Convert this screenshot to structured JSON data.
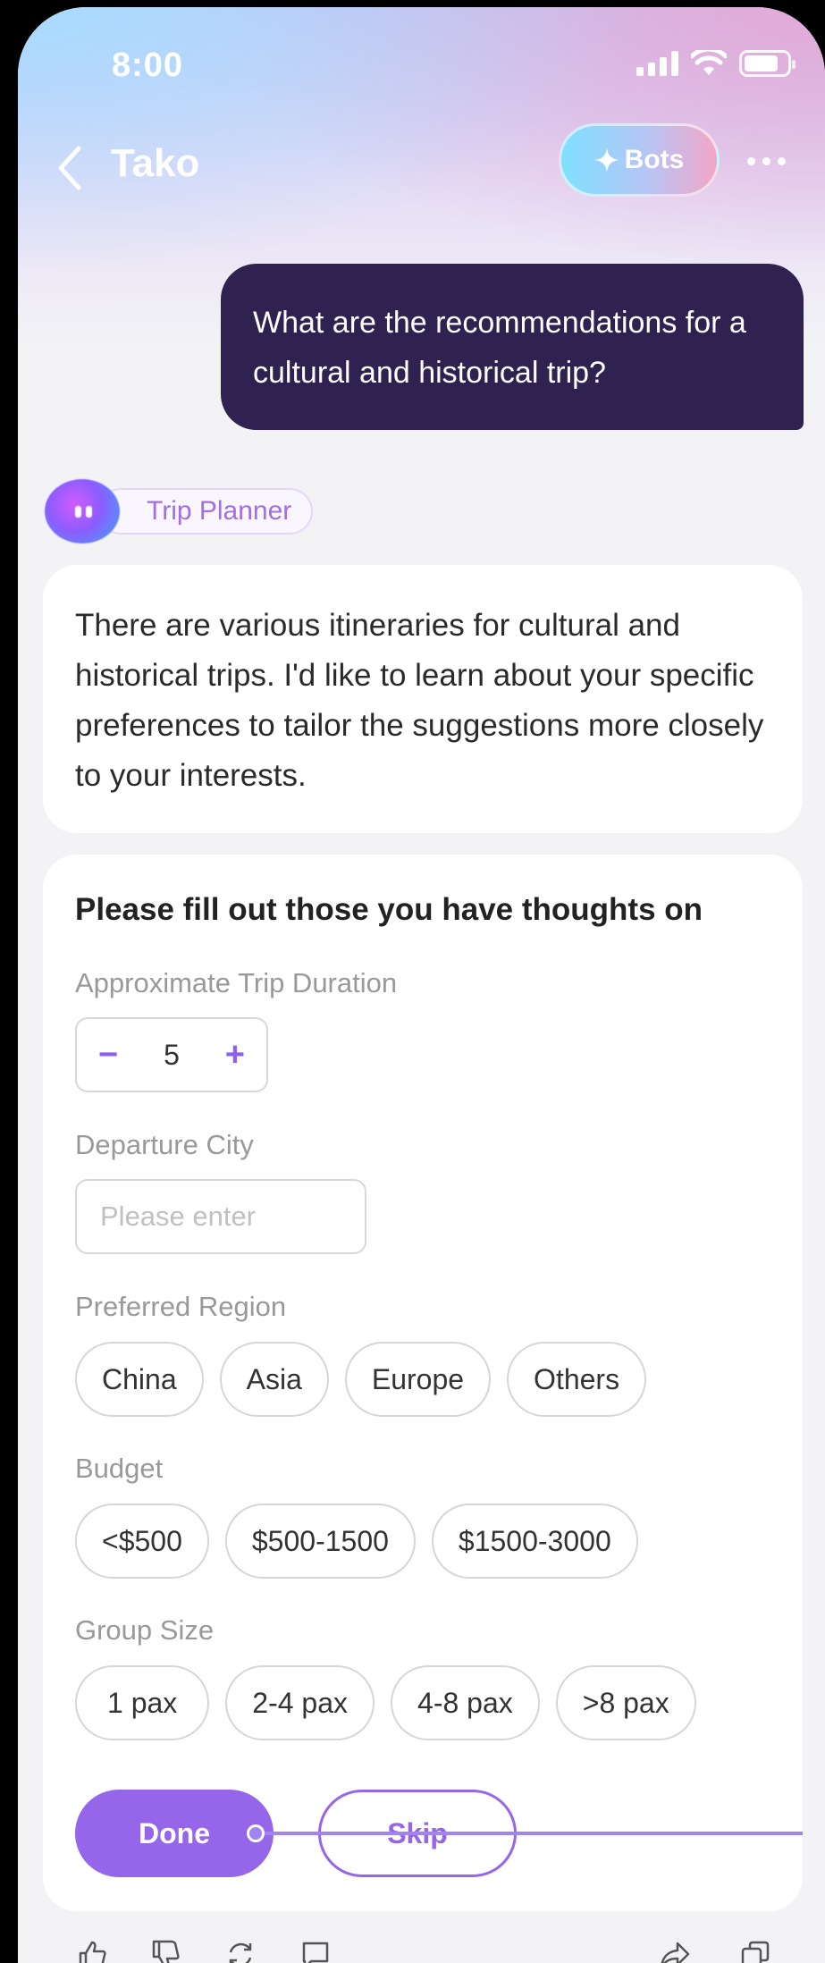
{
  "status_bar": {
    "time": "8:00"
  },
  "header": {
    "title": "Tako",
    "bots_label": "Bots"
  },
  "user_message": "What are the recommendations for a cultural and historical trip?",
  "bot": {
    "name": "Trip Planner"
  },
  "bot_message": "There are various itineraries for cultural and historical trips. I'd like to learn about your specific preferences to tailor the suggestions more closely to your interests.",
  "form": {
    "title": "Please fill out those you have thoughts on",
    "duration": {
      "label": "Approximate Trip Duration",
      "value": "5",
      "minus": "−",
      "plus": "+"
    },
    "departure": {
      "label": "Departure City",
      "placeholder": "Please enter"
    },
    "region": {
      "label": "Preferred Region",
      "options": [
        "China",
        "Asia",
        "Europe",
        "Others"
      ]
    },
    "budget": {
      "label": "Budget",
      "options": [
        "<$500",
        "$500-1500",
        "$1500-3000"
      ]
    },
    "group": {
      "label": "Group Size",
      "options": [
        "1 pax",
        "2-4 pax",
        "4-8 pax",
        ">8 pax"
      ]
    },
    "done_label": "Done",
    "skip_label": "Skip"
  },
  "colors": {
    "accent": "#9565ea",
    "user_bubble": "#2f2150"
  },
  "icons": [
    "thumbs-up-icon",
    "thumbs-down-icon",
    "regenerate-icon",
    "comment-icon",
    "share-icon",
    "copy-icon"
  ]
}
